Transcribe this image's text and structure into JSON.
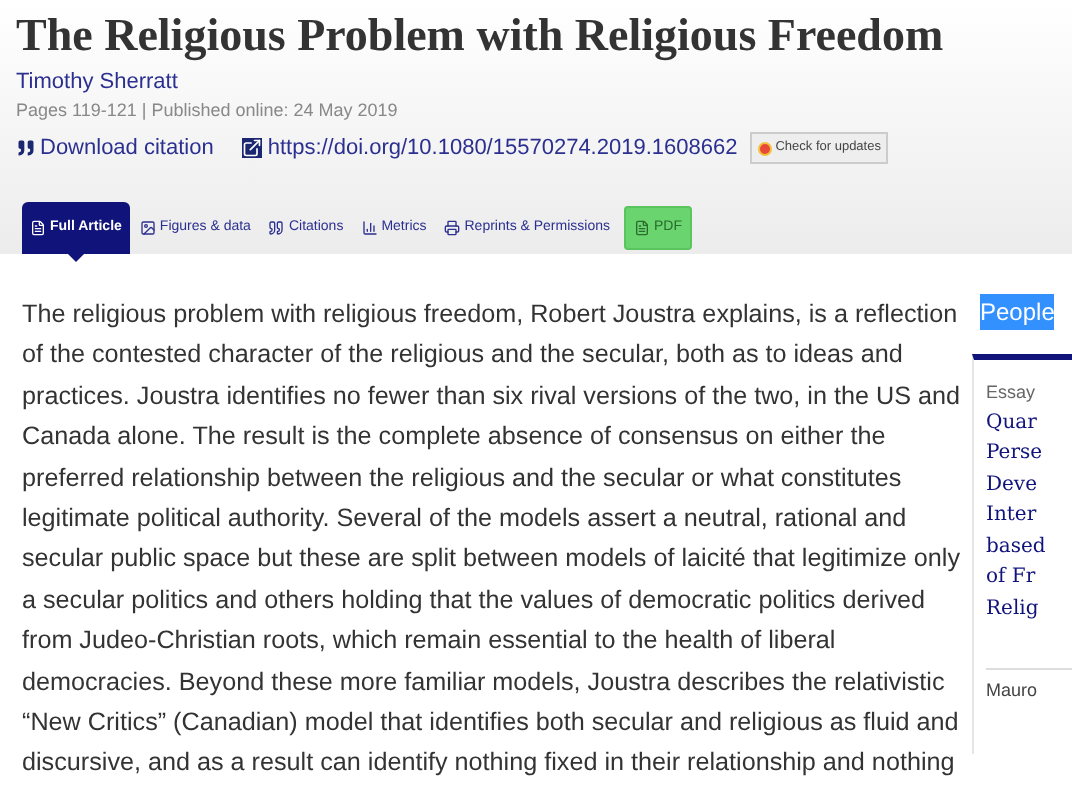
{
  "article": {
    "title": "The Religious Problem with Religious Freedom",
    "author": "Timothy Sherratt",
    "meta": "Pages 119-121 | Published online: 24 May 2019",
    "download_citation": "Download citation",
    "doi": "https://doi.org/10.1080/15570274.2019.1608662",
    "check_updates": "Check for updates"
  },
  "tabs": [
    {
      "label": "Full Article",
      "selected": true
    },
    {
      "label": "Figures & data",
      "selected": false
    },
    {
      "label": "Citations",
      "selected": false
    },
    {
      "label": "Metrics",
      "selected": false
    },
    {
      "label": "Reprints & Permissions",
      "selected": false
    }
  ],
  "pdf_button": "PDF",
  "body": "The religious problem with religious freedom, Robert Joustra explains, is a reflection of the contested character of the religious and the secular, both as to ideas and practices. Joustra identifies no fewer than six rival versions of the two, in the US and Canada alone. The result is the complete absence of consensus on either the preferred relationship between the religious and the secular or what constitutes legitimate political authority. Several of the models assert a neutral, rational and secular public space but these are split between models of laicité that legitimize only a secular politics and others holding that the values of democratic politics derived from Judeo-Christian roots, which remain essential to the health of liberal democracies. Beyond these more familiar models, Joustra describes the relativistic “New Critics” (Canadian) model that identifies both secular and religious as fluid and discursive, and as a result can identify nothing fixed in their relationship and nothing",
  "sidebar": {
    "heading": "People",
    "card": {
      "type": "Essay",
      "title_lines": [
        "Quar",
        "Perse",
        "Deve",
        "Inter",
        "based",
        "of Fr",
        "Relig"
      ],
      "author": "Mauro"
    }
  }
}
